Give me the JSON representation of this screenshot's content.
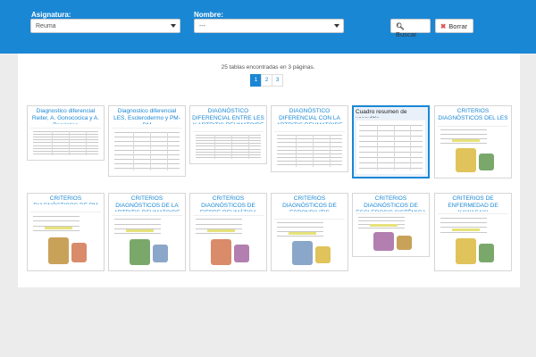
{
  "header": {
    "asignatura_label": "Asignatura:",
    "asignatura_value": "Reuma",
    "nombre_label": "Nombre:",
    "nombre_value": "---",
    "buscar_label": "Buscar",
    "borrar_label": "Borrar"
  },
  "results": {
    "summary": "25 tablas encontradas en 3 páginas.",
    "pages": [
      "1",
      "2",
      "3"
    ],
    "active_page": "1"
  },
  "cards": [
    {
      "title": "Diagnostico diferencial Reiter, A. Gonococica y A. Psoriatica",
      "thumb": "table"
    },
    {
      "title": "Diagnostico diferencial LES, Esclerodermo y PM-DM",
      "thumb": "table"
    },
    {
      "title": "DIAGNÓSTICO DIFERENCIAL ENTRE LES Y ARTRITIS REUMATOIDE",
      "thumb": "table"
    },
    {
      "title": "DIAGNÓSTICO DIFERENCIAL CON LA ARTRITIS REUMATOIDE",
      "thumb": "table"
    },
    {
      "title": "Cuadro resumen de vasculitis",
      "thumb": "table",
      "selected": true
    },
    {
      "title": "CRITERIOS DIAGNÓSTICOS DEL LES",
      "thumb": "illustration"
    },
    {
      "title": "CRITERIOS DIAGNÓSTICOS DE PM",
      "thumb": "illustration"
    },
    {
      "title": "CRITERIOS DIAGNÓSTICOS DE LA ARTRITIS REUMATOIDE",
      "thumb": "illustration"
    },
    {
      "title": "CRITERIOS DIAGNÓSTICOS DE FIEBRE REUMÁTICA",
      "thumb": "illustration"
    },
    {
      "title": "CRITERIOS DIAGNÓSTICOS DE ESPONDILITIS ANQUILOPOYÉTICA",
      "thumb": "illustration"
    },
    {
      "title": "CRITERIOS DIAGNÓSTICOS DE ESCLEROSIS SISTÉMICA",
      "thumb": "illustration"
    },
    {
      "title": "CRITERIOS DE ENFERMEDAD DE KAWASAKI",
      "thumb": "illustration"
    }
  ]
}
